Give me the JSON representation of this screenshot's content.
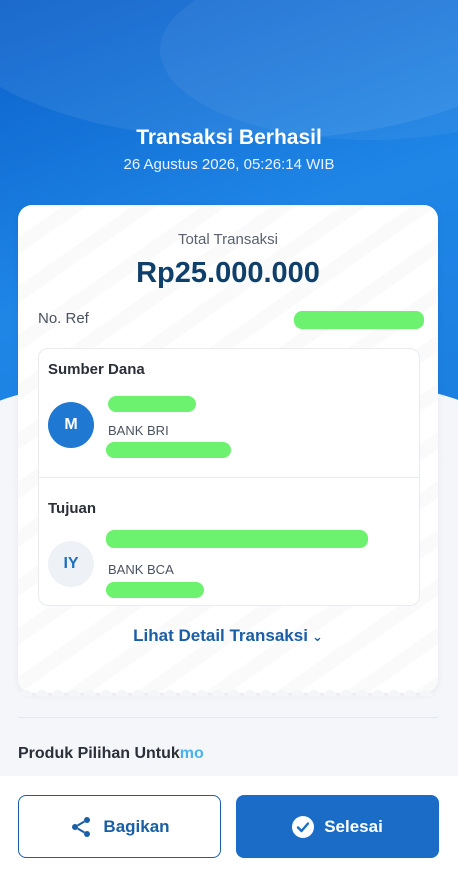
{
  "header": {
    "title": "Transaksi Berhasil",
    "datetime": "26 Agustus 2026, 05:26:14 WIB"
  },
  "receipt": {
    "total_label": "Total Transaksi",
    "total_amount": "Rp25.000.000",
    "ref_label": "No. Ref",
    "source": {
      "section_title": "Sumber Dana",
      "avatar_initial": "M",
      "bank": "BANK BRI"
    },
    "destination": {
      "section_title": "Tujuan",
      "avatar_initial": "IY",
      "bank": "BANK BCA"
    },
    "detail_link": "Lihat Detail Transaksi"
  },
  "promo": {
    "title": "Produk Pilihan Untuk",
    "brand": "mo"
  },
  "actions": {
    "share_label": "Bagikan",
    "done_label": "Selesai"
  },
  "colors": {
    "primary": "#1a6cc6",
    "hero": "#1f86e6",
    "amount": "#0f3f6b",
    "redaction": "#6df26f"
  }
}
